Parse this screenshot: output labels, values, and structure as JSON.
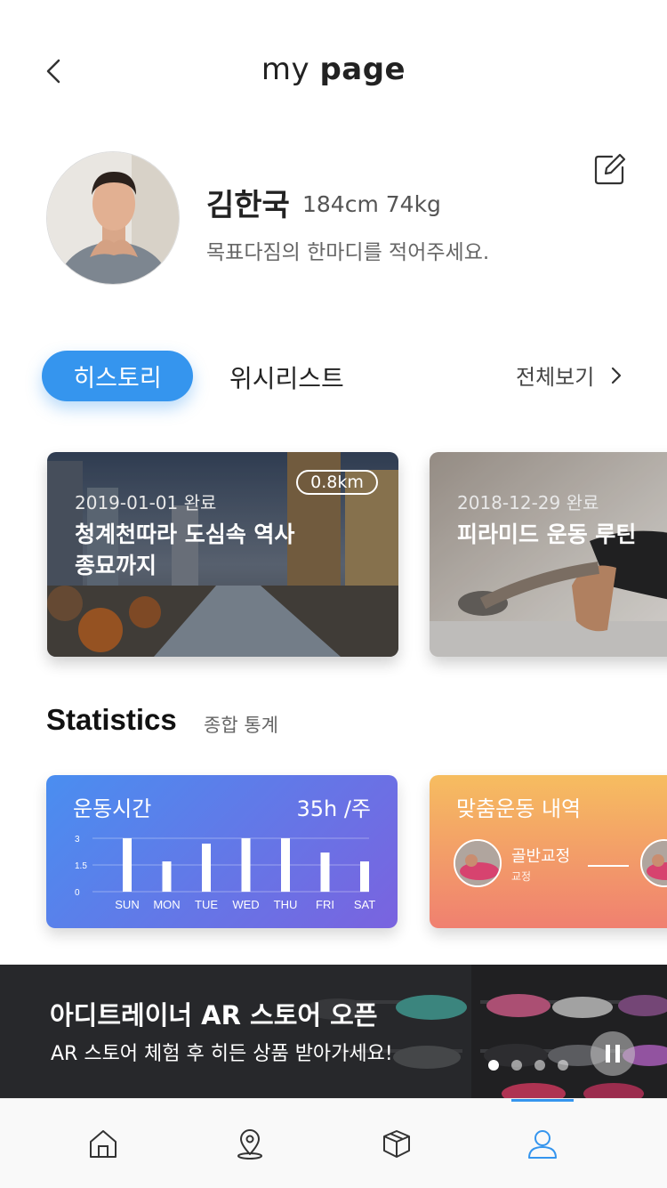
{
  "header": {
    "title_light": "my ",
    "title_bold": "page"
  },
  "profile": {
    "name": "김한국",
    "body_info": "184cm 74kg",
    "motto": "목표다짐의 한마디를 적어주세요."
  },
  "tabs": {
    "active": "히스토리",
    "inactive": "위시리스트",
    "view_all": "전체보기"
  },
  "history": [
    {
      "date": "2019-01-01 완료",
      "title": "청계천따라 도심속 역사 종묘까지",
      "distance": "0.8km"
    },
    {
      "date": "2018-12-29 완료",
      "title": "피라미드 운동 루틴"
    }
  ],
  "statistics": {
    "title": "Statistics",
    "subtitle": "종합 통계",
    "exercise_time": {
      "label": "운동시간",
      "value": "35h /주"
    },
    "custom_history": {
      "label": "맞춤운동 내역",
      "item_name": "골반교정",
      "item_sub": "교정"
    }
  },
  "chart_data": {
    "type": "bar",
    "categories": [
      "SUN",
      "MON",
      "TUE",
      "WED",
      "THU",
      "FRI",
      "SAT"
    ],
    "values": [
      3,
      1.7,
      2.7,
      3,
      3,
      2.2,
      1.7
    ],
    "yticks": [
      "3",
      "1.5",
      "0"
    ],
    "ylim": [
      0,
      3
    ],
    "title": "",
    "xlabel": "",
    "ylabel": ""
  },
  "banner": {
    "title": "아디트레이너 AR 스토어 오픈",
    "subtitle": "AR 스토어 체험 후 히든 상품 받아가세요!",
    "slides": 4,
    "active_slide": 1
  },
  "nav": {
    "items": [
      "home-icon",
      "location-icon",
      "box-icon",
      "user-icon"
    ],
    "active_index": 3,
    "accent": "#3595ee"
  },
  "colors": {
    "accent": "#3595ee",
    "stat_card_from": "#4a8ef0",
    "stat_card_to": "#7a63df",
    "custom_card_from": "#f6bd60",
    "custom_card_to": "#f08070"
  }
}
